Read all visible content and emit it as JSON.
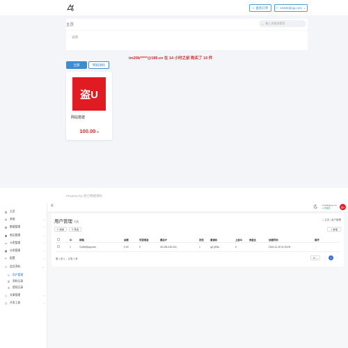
{
  "shop": {
    "top_buttons": {
      "orders_label": "查询订单",
      "user_label": "12345@qq.com"
    },
    "breadcrumb": "主页",
    "search_placeholder": "输入关键词搜索",
    "notice": "说明",
    "marquee": {
      "buyer": "tm20b*****@189.cn",
      "mid": " 在 14 小时之前 购买了 ",
      "count": "10 件"
    },
    "tabs": [
      "全部",
      "网站源码"
    ],
    "product": {
      "logo_text": "盗U",
      "name": "网站搭建",
      "price": "100.00",
      "price_unit": "¥"
    },
    "powered_by": "Powered by 昆仑网络源码"
  },
  "admin": {
    "header": {
      "user_name": "12345@qq.com",
      "user_role": "管理员",
      "avatar_text": "盗U"
    },
    "sidebar": [
      {
        "label": "主页",
        "icon": "chart-icon"
      },
      {
        "label": "系统",
        "icon": "gear-icon",
        "chevron": "‹"
      },
      {
        "label": "数据管理",
        "icon": "database-icon",
        "chevron": "‹"
      },
      {
        "label": "商品管理",
        "icon": "box-icon",
        "chevron": "‹"
      },
      {
        "label": "卡密管理",
        "icon": "card-icon",
        "chevron": "‹"
      },
      {
        "label": "分类管理",
        "icon": "folder-icon",
        "chevron": "‹"
      },
      {
        "label": "配置",
        "icon": "wrench-icon",
        "chevron": "‹"
      },
      {
        "label": "会员资料",
        "icon": "user-icon",
        "chevron": "⌄"
      },
      {
        "label": "用户管理",
        "icon": "user-icon",
        "sub": true,
        "active": true
      },
      {
        "label": "资料记录",
        "icon": "list-icon",
        "sub": true
      },
      {
        "label": "提现记录",
        "icon": "money-icon",
        "sub": true
      },
      {
        "label": "文章管理",
        "icon": "doc-icon",
        "chevron": "‹"
      },
      {
        "label": "开发工具",
        "icon": "code-icon",
        "chevron": "‹"
      }
    ],
    "panel": {
      "title": "用户管理",
      "subtitle": "列表",
      "crumb_home": "主页",
      "crumb_current": "用户管理",
      "btn_refresh": "刷新",
      "btn_filter": "筛选",
      "btn_add": "+ 新增",
      "columns": [
        "",
        "ID",
        "邮箱",
        "余额",
        "可提现金",
        "最后IP",
        "状态",
        "邀请码",
        "上级ID",
        "佣金比",
        "创建时间",
        "操作"
      ],
      "rows": [
        [
          "",
          "1",
          "12345@qq.com",
          "0.00",
          "0",
          "49.235.226.216",
          "1",
          "q(r.Q93u",
          "0",
          "",
          "2024-11-19 21:20:09",
          "⋮"
        ]
      ],
      "pager_info": "第 1 到 1 ，共有 1 条",
      "page_size": "10",
      "current_page": "1"
    }
  },
  "colors": {
    "accent": "#1f6fb5",
    "brand_red": "#e01b22",
    "price_red": "#e02424"
  }
}
